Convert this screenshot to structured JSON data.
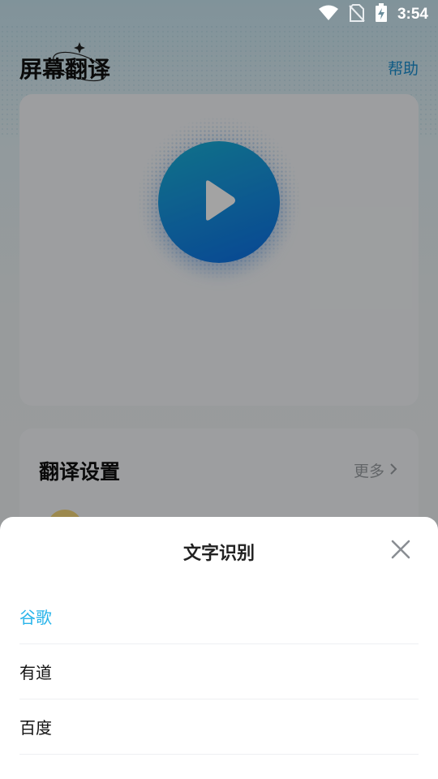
{
  "status_bar": {
    "time": "3:54",
    "icons": [
      "wifi-icon",
      "no-sim-icon",
      "battery-charging-icon"
    ]
  },
  "header": {
    "title": "屏幕翻译",
    "help": "帮助"
  },
  "player": {
    "icon": "play-icon",
    "accent_colors": [
      "#19b2d6",
      "#0d6fe6"
    ]
  },
  "settings": {
    "title": "翻译设置",
    "more": "更多"
  },
  "sheet": {
    "title": "文字识别",
    "close_icon": "close-icon",
    "options": [
      {
        "label": "谷歌",
        "selected": true
      },
      {
        "label": "有道",
        "selected": false
      },
      {
        "label": "百度",
        "selected": false
      }
    ],
    "selected_color": "#28b4ea"
  }
}
